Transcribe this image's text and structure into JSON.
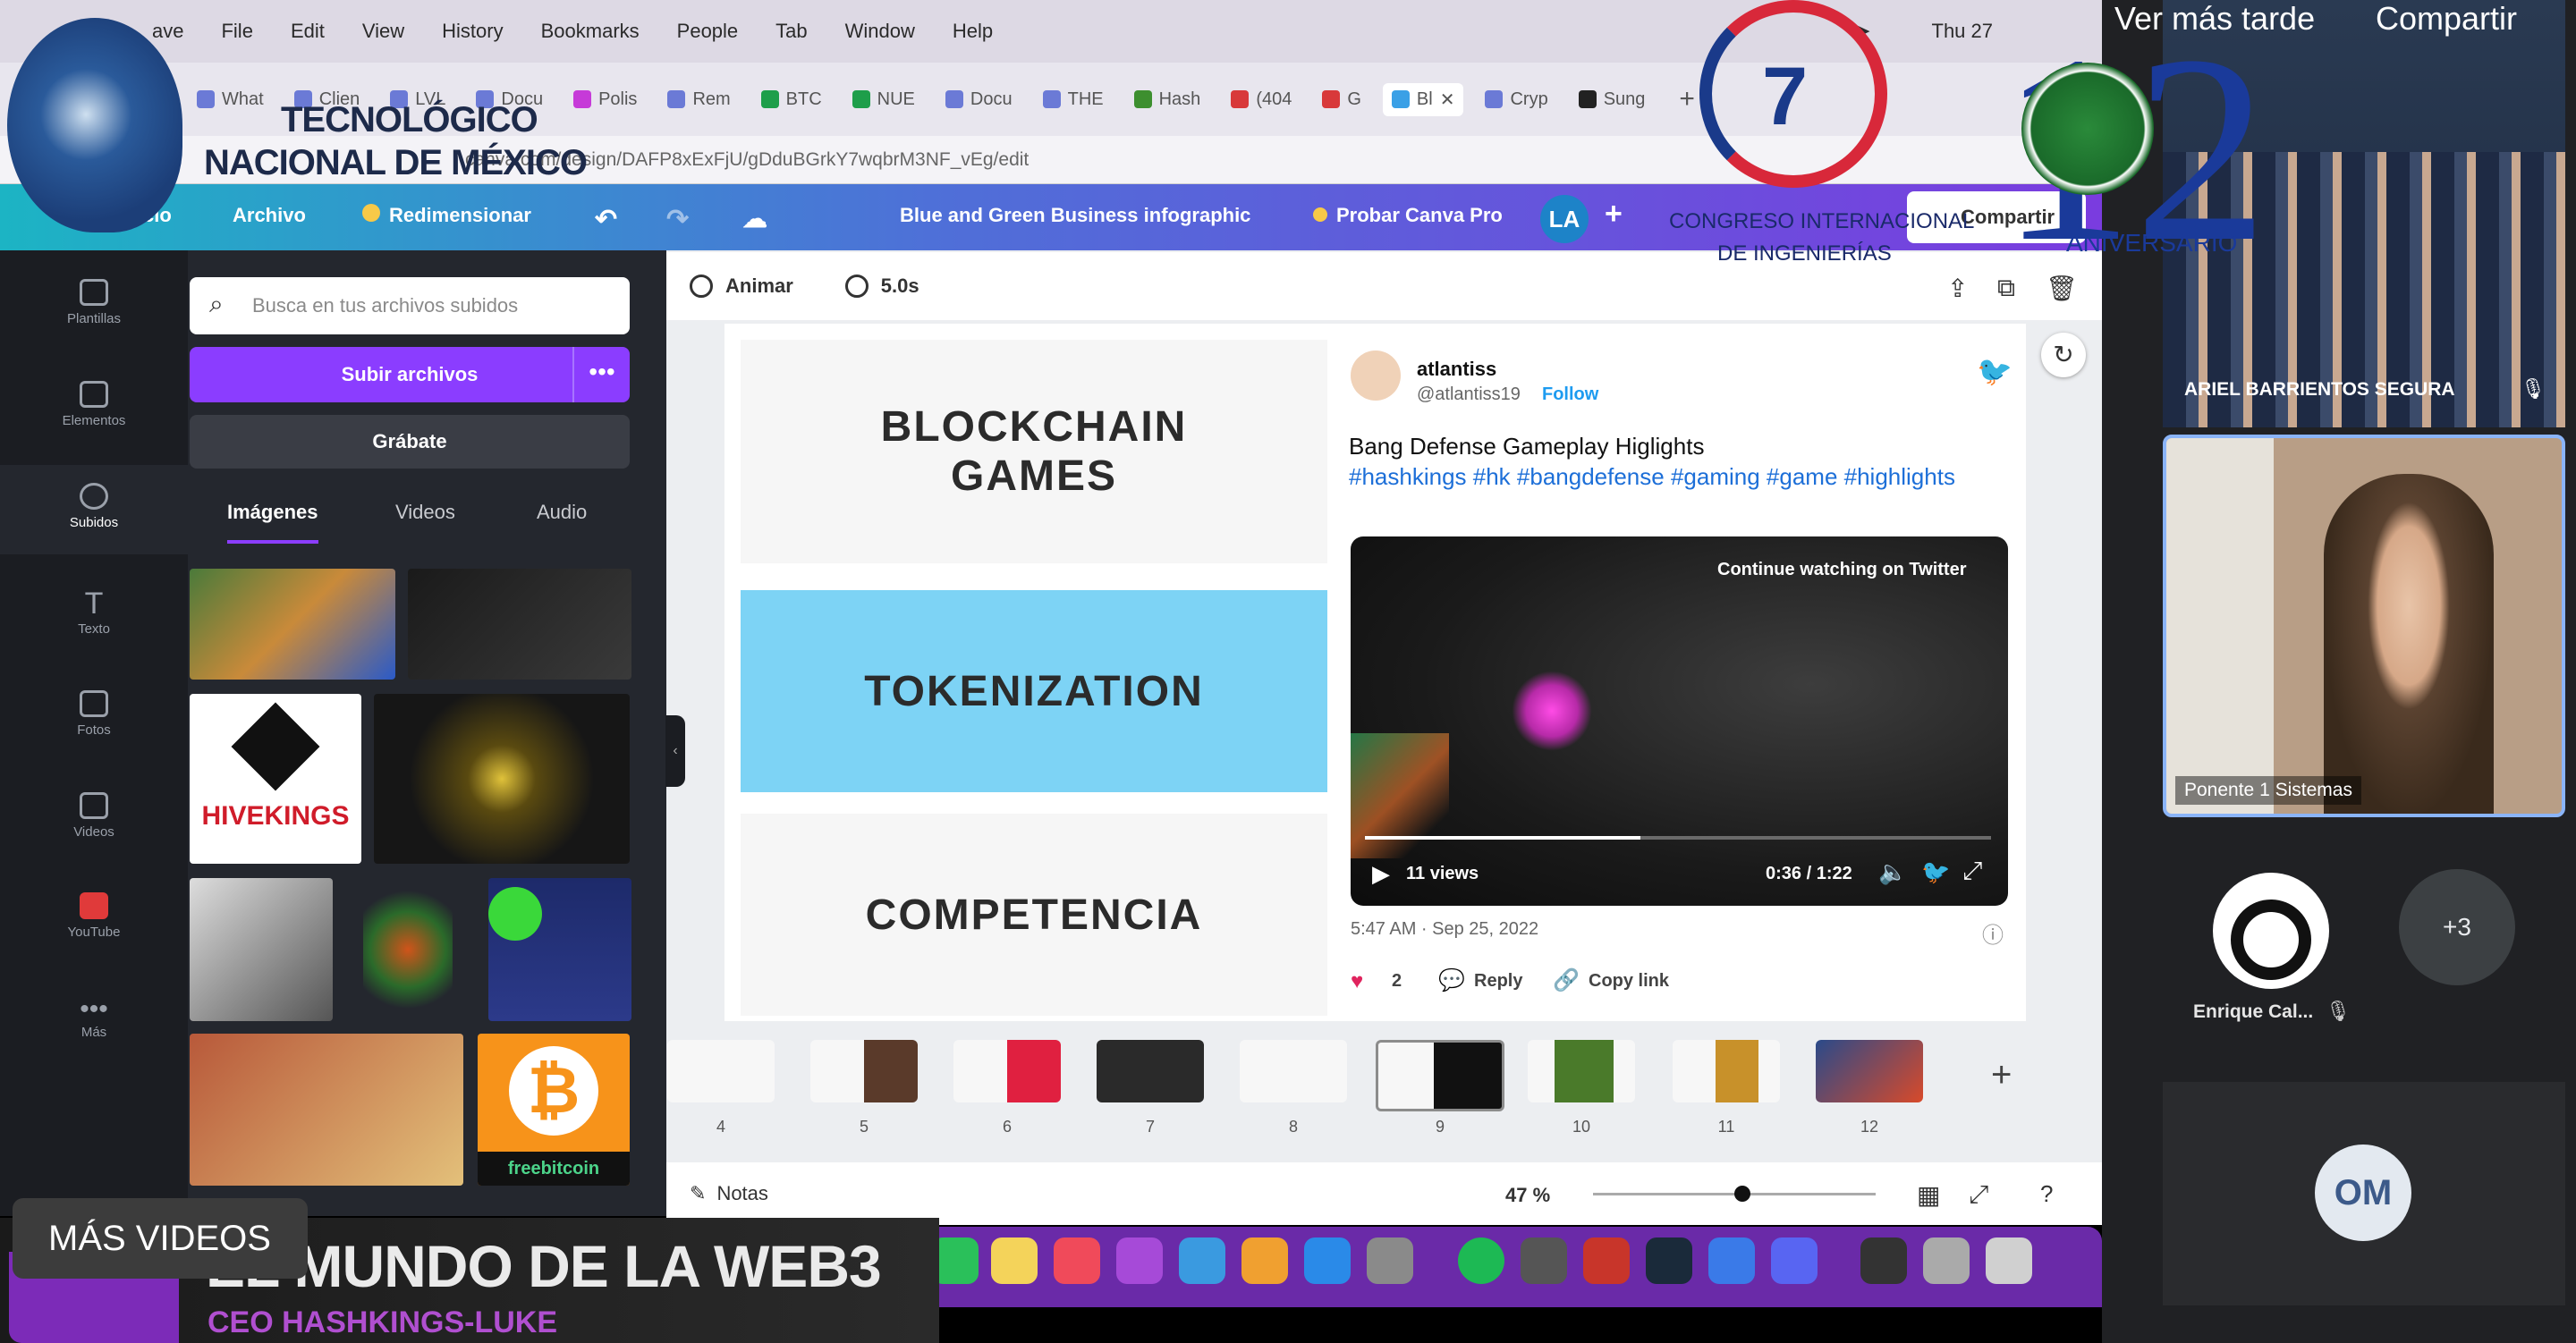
{
  "menubar": {
    "app": "ave",
    "items": [
      "File",
      "Edit",
      "View",
      "History",
      "Bookmarks",
      "People",
      "Tab",
      "Window",
      "Help"
    ],
    "clock": "Thu 27"
  },
  "tabs": [
    "What",
    "Clien",
    "LVL",
    "Docu",
    "Polis",
    "Rem",
    "BTC",
    "NUE",
    "Docu",
    "THE",
    "Hash",
    "(404",
    "G",
    "Bl",
    "Cryp",
    "Sung"
  ],
  "url": "canva.com/design/DAFP8xExFjU/gDduBGrkY7wqbrM3NF_vEg/edit",
  "canva": {
    "home": "cio",
    "archivo": "Archivo",
    "resize": "Redimensionar",
    "title": "Blue and Green Business infographic",
    "pro": "Probar Canva Pro",
    "avatar": "LA",
    "share": "Compartir"
  },
  "rail": [
    "Plantillas",
    "Elementos",
    "Subidos",
    "Texto",
    "Fotos",
    "Videos",
    "YouTube",
    "Más"
  ],
  "panel": {
    "search_placeholder": "Busca en tus archivos subidos",
    "upload": "Subir archivos",
    "more": "•••",
    "record": "Grábate",
    "tabs": [
      "Imágenes",
      "Videos",
      "Audio"
    ],
    "hivekings": "HIVEKINGS",
    "freebitcoin": "freebitcoin"
  },
  "editor": {
    "animate": "Animar",
    "duration": "5.0s",
    "slide": {
      "block1": "BLOCKCHAIN\nGAMES",
      "block2": "TOKENIZATION",
      "block3": "COMPETENCIA"
    },
    "tweet": {
      "name": "atlantiss",
      "handle": "@atlantiss19",
      "follow": "Follow",
      "text": "Bang Defense Gameplay Higlights",
      "tags": "#hashkings #hk #bangdefense #gaming #game #highlights",
      "continue": "Continue watching on Twitter",
      "views": "11 views",
      "time": "0:36 / 1:22",
      "date": "5:47 AM · Sep 25, 2022",
      "likes": "2",
      "reply": "Reply",
      "copy": "Copy link"
    },
    "pages": [
      "4",
      "5",
      "6",
      "7",
      "8",
      "9",
      "10",
      "11",
      "12"
    ],
    "notes": "Notas",
    "zoom": "47 %"
  },
  "overlay": {
    "logo_line1": "TECNOLÓGICO",
    "logo_line2": "NACIONAL DE MÉXICO",
    "congreso1": "CONGRESO INTERNACIONAL",
    "congreso2": "DE INGENIERÍAS",
    "aniversario": "ANIVERSARIO",
    "anniv_number": "12",
    "ver_mas": "Ver más tarde",
    "compartir": "Compartir",
    "mas_videos": "MÁS VIDEOS",
    "lower_title": "EL MUNDO DE LA WEB3",
    "lower_sub": "CEO HASHKINGS-LUKE"
  },
  "meet": {
    "p1": "ARIEL BARRIENTOS SEGURA",
    "p2": "Ponente 1 Sistemas",
    "p3": "Enrique Cal...",
    "more": "+3",
    "om": "OM"
  },
  "colors": {
    "canva_purple": "#8b3dff",
    "tokenization_bg": "#7dd3f5",
    "twitter_blue": "#1d9bf0",
    "meet_highlight": "#8ab4f8"
  }
}
